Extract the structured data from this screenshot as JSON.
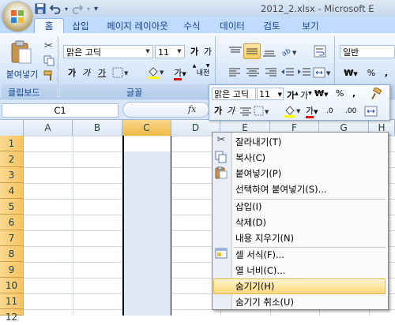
{
  "window": {
    "title": "2012_2.xlsx - Microsoft E"
  },
  "tabs": [
    "홈",
    "삽입",
    "페이지 레이아웃",
    "수식",
    "데이터",
    "검토",
    "보기"
  ],
  "ribbon": {
    "clipboard": {
      "paste_label": "붙여넣기",
      "group_label": "클립보드"
    },
    "font": {
      "font_name": "맑은 고딕",
      "font_size": "11",
      "group_label": "글꼴",
      "bold": "가",
      "italic": "가",
      "underline": "가",
      "grow": "가",
      "shrink": "가",
      "color_letter": "가",
      "phonetic": "내천"
    },
    "alignment": {},
    "number": {
      "format": "일반",
      "currency": "₩",
      "percent": "%",
      "comma": ","
    }
  },
  "formula_bar": {
    "name_box": "C1",
    "fx": "fx"
  },
  "columns": [
    "A",
    "B",
    "C",
    "D",
    "E",
    "F",
    "G",
    "H"
  ],
  "rows": [
    "1",
    "2",
    "3",
    "4",
    "5",
    "6",
    "7",
    "8",
    "9",
    "10",
    "11",
    "12"
  ],
  "mini_toolbar": {
    "font_name": "맑은 고딕",
    "font_size": "11",
    "bold": "가",
    "italic": "가",
    "grow": "가",
    "shrink": "가",
    "currency": "₩",
    "percent": "%",
    "comma": ",",
    "color_letter": "가",
    "inc_decimal": ".00",
    "dec_decimal": ".0"
  },
  "context_menu": {
    "items": [
      {
        "label": "잘라내기(T)"
      },
      {
        "label": "복사(C)"
      },
      {
        "label": "붙여넣기(P)"
      },
      {
        "label": "선택하여 붙여넣기(S)..."
      },
      {
        "label": "삽입(I)"
      },
      {
        "label": "삭제(D)"
      },
      {
        "label": "내용 지우기(N)"
      },
      {
        "label": "셀 서식(F)..."
      },
      {
        "label": "열 너비(C)..."
      },
      {
        "label": "숨기기(H)"
      },
      {
        "label": "숨기기 취소(U)"
      }
    ],
    "highlighted": "숨기기(H)"
  },
  "colors": {
    "accent": "#15428b",
    "ribbon_bg": "#d9e7f9",
    "selected_header": "#f7c35f",
    "menu_highlight": "#fbd97c"
  }
}
